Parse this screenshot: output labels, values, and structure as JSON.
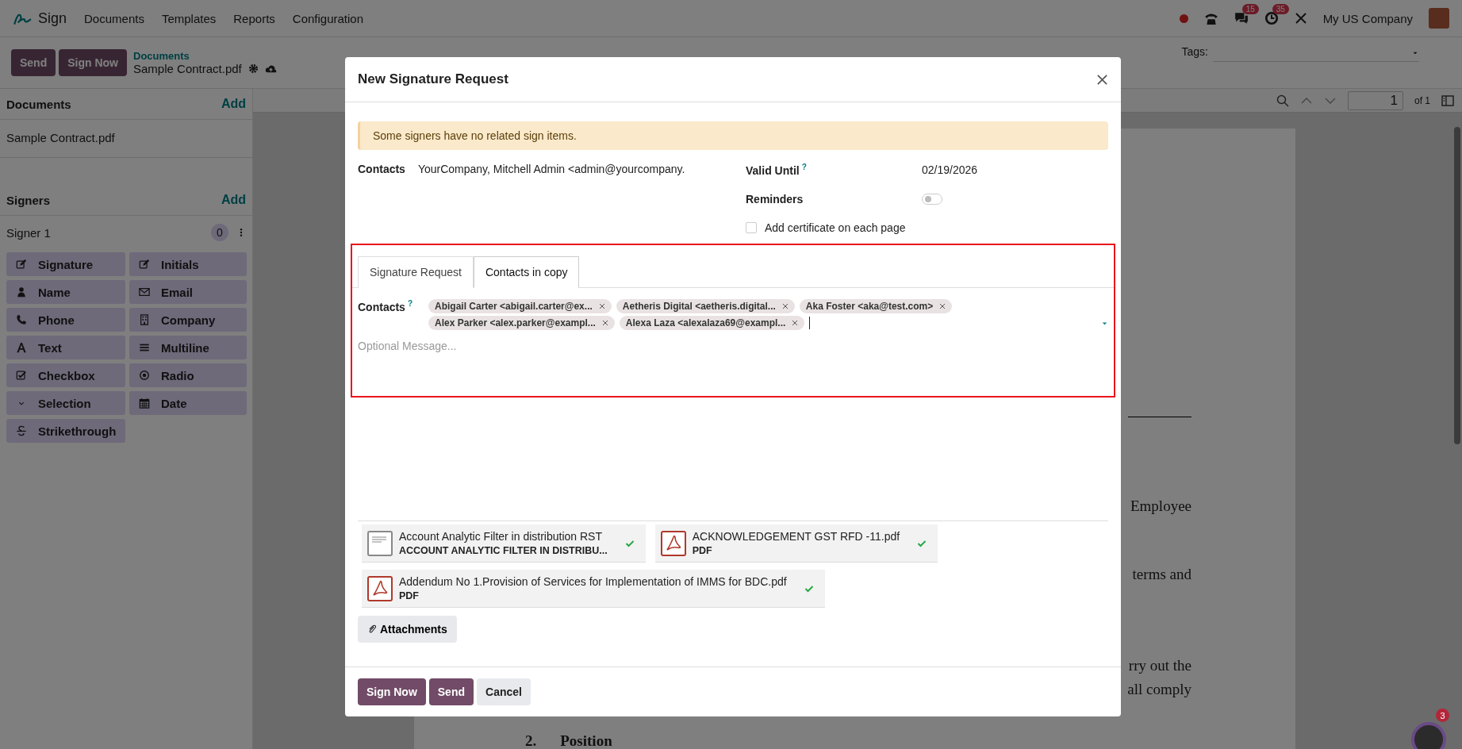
{
  "navbar": {
    "app_name": "Sign",
    "menu": [
      "Documents",
      "Templates",
      "Reports",
      "Configuration"
    ],
    "messages_count": "15",
    "activities_count": "35",
    "company": "My US Company"
  },
  "control_panel": {
    "buttons": [
      "Send",
      "Sign Now"
    ],
    "breadcrumb": "Documents",
    "record": "Sample Contract.pdf",
    "tags_label": "Tags:"
  },
  "sidebar": {
    "documents_title": "Documents",
    "documents_add": "Add",
    "documents": [
      "Sample Contract.pdf"
    ],
    "signers_title": "Signers",
    "signers_add": "Add",
    "signer": "Signer 1",
    "signer_count": "0",
    "field_types": [
      {
        "label": "Signature",
        "kind": "signature"
      },
      {
        "label": "Initials",
        "kind": "initials"
      },
      {
        "label": "Name",
        "kind": "name"
      },
      {
        "label": "Email",
        "kind": "email"
      },
      {
        "label": "Phone",
        "kind": "phone"
      },
      {
        "label": "Company",
        "kind": "company"
      },
      {
        "label": "Text",
        "kind": "text"
      },
      {
        "label": "Multiline",
        "kind": "multiline"
      },
      {
        "label": "Checkbox",
        "kind": "checkbox"
      },
      {
        "label": "Radio",
        "kind": "radio"
      },
      {
        "label": "Selection",
        "kind": "selection"
      },
      {
        "label": "Date",
        "kind": "date"
      },
      {
        "label": "Strikethrough",
        "kind": "strikethrough"
      }
    ]
  },
  "pdf_viewer": {
    "page_number": "1",
    "page_count": "of 1",
    "text_fragments": [
      "Employee",
      "terms and",
      "rry out the",
      "all comply"
    ],
    "section_number": "2.",
    "section_title": "Position"
  },
  "chat_widget": {
    "badge": "3"
  },
  "dialog": {
    "title": "New Signature Request",
    "alert": "Some signers have no related sign items.",
    "contacts_label": "Contacts",
    "contacts_value": "YourCompany, Mitchell Admin <admin@yourcompany.",
    "valid_until_label": "Valid Until",
    "valid_until_help": "?",
    "valid_until": "02/19/2026",
    "reminders_label": "Reminders",
    "reminders_on": false,
    "certificate_label": "Add certificate on each page",
    "certificate_checked": false,
    "tabs": [
      {
        "label": "Signature Request",
        "selected": false
      },
      {
        "label": "Contacts in copy",
        "selected": true
      }
    ],
    "cc_label": "Contacts",
    "cc_help": "?",
    "cc_tags": [
      "Abigail Carter <abigail.carter@ex...",
      "Aetheris Digital <aetheris.digital...",
      "Aka Foster <aka@test.com>",
      "Alex Parker <alex.parker@exampl...",
      "Alexa Laza <alexalaza69@exampl..."
    ],
    "message_placeholder": "Optional Message...",
    "attachments": [
      {
        "name": "Account Analytic Filter in distribution RST",
        "subtitle": "ACCOUNT ANALYTIC FILTER IN DISTRIBU...",
        "kind": "doc"
      },
      {
        "name": "ACKNOWLEDGEMENT GST RFD -11.pdf",
        "subtitle": "PDF",
        "kind": "pdf"
      },
      {
        "name": "Addendum No 1.Provision of Services for Implementation of IMMS for BDC.pdf",
        "subtitle": "PDF",
        "kind": "pdf"
      }
    ],
    "attachments_button": "Attachments",
    "footer_buttons": [
      {
        "label": "Sign Now",
        "kind": "primary"
      },
      {
        "label": "Send",
        "kind": "primary"
      },
      {
        "label": "Cancel",
        "kind": "secondary"
      }
    ]
  }
}
